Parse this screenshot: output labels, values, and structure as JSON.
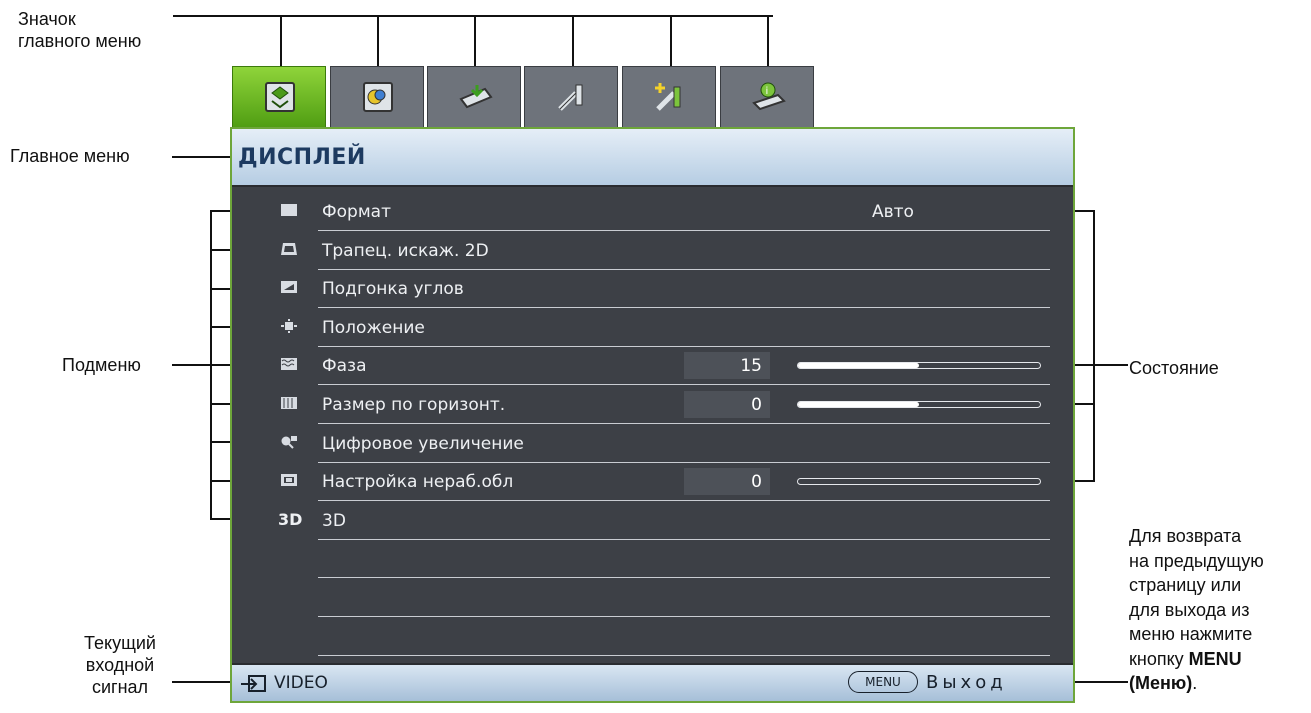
{
  "annotations": {
    "main_icon_line1": "Значок",
    "main_icon_line2": "главного меню",
    "main_menu": "Главное меню",
    "submenu": "Подменю",
    "status": "Состояние",
    "current_input_line1": "Текущий",
    "current_input_line2": "входной",
    "current_input_line3": "сигнал",
    "back_line1": "Для возврата",
    "back_line2": "на предыдущую",
    "back_line3": "страницу или",
    "back_line4": "для выхода из",
    "back_line5": "меню нажмите",
    "back_line6_prefix": "кнопку ",
    "back_line6_bold": "MENU",
    "back_line7_bold": "(Меню)",
    "back_line7_suffix": "."
  },
  "tabs": [
    {
      "icon": "display-settings-icon",
      "active": true
    },
    {
      "icon": "picture-settings-icon",
      "active": false
    },
    {
      "icon": "source-input-icon",
      "active": false
    },
    {
      "icon": "system-setup-basic-icon",
      "active": false
    },
    {
      "icon": "system-setup-advanced-icon",
      "active": false
    },
    {
      "icon": "information-icon",
      "active": false
    }
  ],
  "menu": {
    "title": "ДИСПЛЕЙ",
    "items": [
      {
        "label": "Формат",
        "icon": "aspect-ratio-icon",
        "value": "Авто"
      },
      {
        "label": "Трапец. искаж. 2D",
        "icon": "keystone-icon"
      },
      {
        "label": "Подгонка углов",
        "icon": "corner-fit-icon"
      },
      {
        "label": "Положение",
        "icon": "position-icon"
      },
      {
        "label": "Фаза",
        "icon": "phase-icon",
        "number": "15",
        "level": 0.5
      },
      {
        "label": "Размер по горизонт.",
        "icon": "h-size-icon",
        "number": "0",
        "level": 0.5
      },
      {
        "label": "Цифровое увеличение",
        "icon": "digital-zoom-icon"
      },
      {
        "label": "Настройка нераб.обл",
        "icon": "overscan-icon",
        "number": "0",
        "level": 0.0
      },
      {
        "label": "3D",
        "icon": "3d-icon",
        "icon_text": "3D"
      }
    ]
  },
  "footer": {
    "source": "VIDEO",
    "menu_key": "MENU",
    "exit": "Выход"
  },
  "colors": {
    "panel_bg": "#3d4046",
    "title_bar": "#c7d9ea",
    "active_tab": "#6fbf24",
    "title_text": "#1d3a60"
  }
}
